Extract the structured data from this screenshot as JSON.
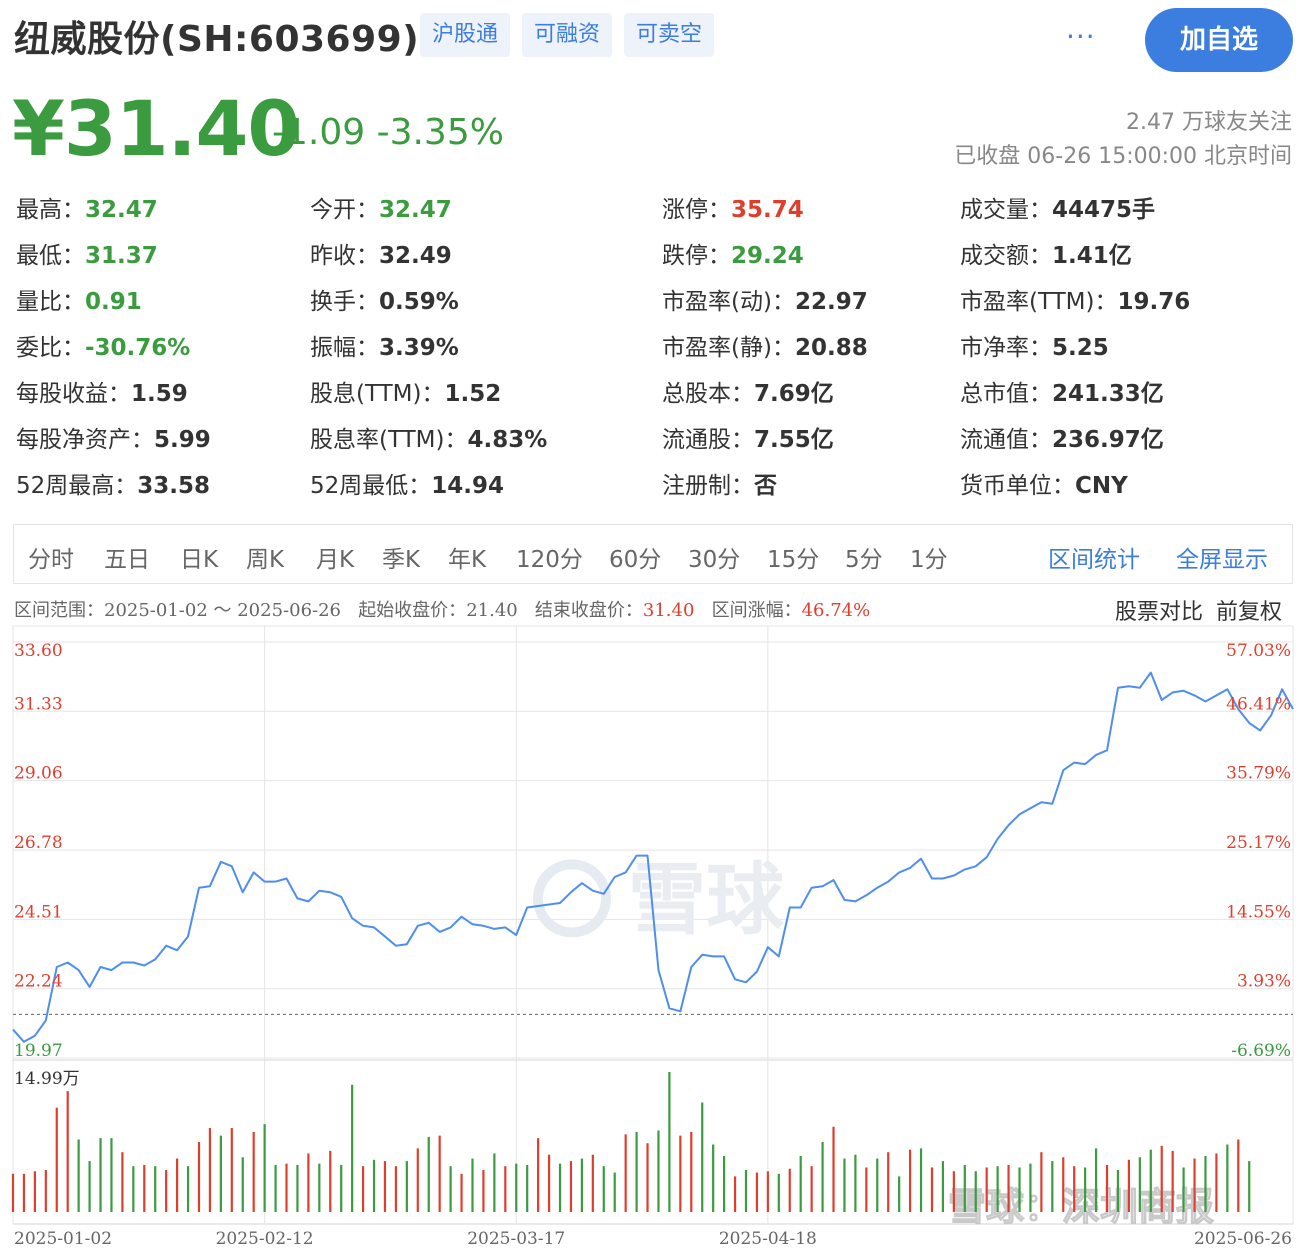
{
  "header": {
    "title": "纽威股份(SH:603699)",
    "tags": [
      "沪股通",
      "可融资",
      "可卖空"
    ],
    "more": "···",
    "add_button": "加自选"
  },
  "quote": {
    "price": "¥31.40",
    "change": "-1.09 -3.35%",
    "followers": "2.47 万球友关注",
    "status_time": "已收盘 06-26 15:00:00 北京时间"
  },
  "stats": {
    "col1": [
      {
        "label": "最高：",
        "value": "32.47",
        "color": "#3a9b3f"
      },
      {
        "label": "最低：",
        "value": "31.37",
        "color": "#3a9b3f"
      },
      {
        "label": "量比：",
        "value": "0.91",
        "color": "#3a9b3f"
      },
      {
        "label": "委比：",
        "value": "-30.76%",
        "color": "#3a9b3f"
      },
      {
        "label": "每股收益：",
        "value": "1.59",
        "color": "#333333"
      },
      {
        "label": "每股净资产：",
        "value": "5.99",
        "color": "#333333"
      },
      {
        "label": "52周最高：",
        "value": "33.58",
        "color": "#333333"
      }
    ],
    "col2": [
      {
        "label": "今开：",
        "value": "32.47",
        "color": "#3a9b3f"
      },
      {
        "label": "昨收：",
        "value": "32.49",
        "color": "#333333"
      },
      {
        "label": "换手：",
        "value": "0.59%",
        "color": "#333333"
      },
      {
        "label": "振幅：",
        "value": "3.39%",
        "color": "#333333"
      },
      {
        "label": "股息(TTM)：",
        "value": "1.52",
        "color": "#333333"
      },
      {
        "label": "股息率(TTM)：",
        "value": "4.83%",
        "color": "#333333"
      },
      {
        "label": "52周最低：",
        "value": "14.94",
        "color": "#333333"
      }
    ],
    "col3": [
      {
        "label": "涨停：",
        "value": "35.74",
        "color": "#e03e2d"
      },
      {
        "label": "跌停：",
        "value": "29.24",
        "color": "#3a9b3f"
      },
      {
        "label": "市盈率(动)：",
        "value": "22.97",
        "color": "#333333"
      },
      {
        "label": "市盈率(静)：",
        "value": "20.88",
        "color": "#333333"
      },
      {
        "label": "总股本：",
        "value": "7.69亿",
        "color": "#333333"
      },
      {
        "label": "流通股：",
        "value": "7.55亿",
        "color": "#333333"
      },
      {
        "label": "注册制：",
        "value": "否",
        "color": "#333333"
      }
    ],
    "col4": [
      {
        "label": "成交量：",
        "value": "44475手",
        "color": "#333333"
      },
      {
        "label": "成交额：",
        "value": "1.41亿",
        "color": "#333333"
      },
      {
        "label": "市盈率(TTM)：",
        "value": "19.76",
        "color": "#333333"
      },
      {
        "label": "市净率：",
        "value": "5.25",
        "color": "#333333"
      },
      {
        "label": "总市值：",
        "value": "241.33亿",
        "color": "#333333"
      },
      {
        "label": "流通值：",
        "value": "236.97亿",
        "color": "#333333"
      },
      {
        "label": "货币单位：",
        "value": "CNY",
        "color": "#333333"
      }
    ]
  },
  "tabs": [
    "分时",
    "五日",
    "日K",
    "周K",
    "月K",
    "季K",
    "年K",
    "120分",
    "60分",
    "30分",
    "15分",
    "5分",
    "1分"
  ],
  "tab_actions": [
    "区间统计",
    "全屏显示"
  ],
  "range": {
    "range_label": "区间范围：",
    "range_value": "2025-01-02 ～ 2025-06-26",
    "start_label": "起始收盘价：",
    "start_value": "21.40",
    "end_label": "结束收盘价：",
    "end_value": "31.40",
    "change_label": "区间涨幅：",
    "change_value": "46.74%",
    "compare": "股票对比",
    "adjust": "前复权"
  },
  "watermark": "雪球",
  "corner_watermark": "雪球：深圳商报",
  "chart_data": {
    "type": "line",
    "y_left_ticks": [
      "33.60",
      "31.33",
      "29.06",
      "26.78",
      "24.51",
      "22.24",
      "19.97"
    ],
    "y_right_ticks": [
      "57.03%",
      "46.41%",
      "35.79%",
      "25.17%",
      "14.55%",
      "3.93%",
      "-6.69%"
    ],
    "ylim": [
      19.97,
      33.6
    ],
    "baseline": 21.4,
    "x_ticks": [
      "2025-01-02",
      "2025-02-12",
      "2025-03-17",
      "2025-04-18",
      "2025-06-26"
    ],
    "x_tick_index": [
      0,
      23,
      46,
      69,
      113
    ],
    "price": [
      20.9,
      20.5,
      20.7,
      21.2,
      22.95,
      23.1,
      22.85,
      22.3,
      22.95,
      22.85,
      23.1,
      23.1,
      23.0,
      23.2,
      23.65,
      23.5,
      23.95,
      25.55,
      25.6,
      26.4,
      26.25,
      25.4,
      26.05,
      25.75,
      25.75,
      25.85,
      25.2,
      25.1,
      25.45,
      25.4,
      25.25,
      24.55,
      24.3,
      24.25,
      23.95,
      23.65,
      23.7,
      24.3,
      24.4,
      24.1,
      24.25,
      24.6,
      24.35,
      24.3,
      24.2,
      24.25,
      24.0,
      24.9,
      24.95,
      25.0,
      25.05,
      25.4,
      25.7,
      25.45,
      25.35,
      25.9,
      26.05,
      26.6,
      26.6,
      22.85,
      21.6,
      21.5,
      22.95,
      23.35,
      23.3,
      23.3,
      22.55,
      22.45,
      22.8,
      23.6,
      23.3,
      24.9,
      24.9,
      25.55,
      25.6,
      25.8,
      25.15,
      25.1,
      25.3,
      25.55,
      25.75,
      26.05,
      26.2,
      26.5,
      25.85,
      25.85,
      25.95,
      26.15,
      26.25,
      26.55,
      27.15,
      27.6,
      27.95,
      28.15,
      28.35,
      28.3,
      29.4,
      29.65,
      29.6,
      29.9,
      30.05,
      32.1,
      32.15,
      32.1,
      32.6,
      31.7,
      31.95,
      32.0,
      31.85,
      31.65,
      31.85,
      32.05,
      31.4,
      30.95,
      30.7,
      31.2,
      32.05,
      31.4
    ],
    "volume_max_label": "14.99万",
    "volume": [
      0.3,
      0.3,
      0.32,
      0.33,
      0.82,
      0.95,
      0.57,
      0.4,
      0.58,
      0.58,
      0.47,
      0.36,
      0.37,
      0.36,
      0.33,
      0.42,
      0.36,
      0.55,
      0.66,
      0.6,
      0.66,
      0.43,
      0.63,
      0.69,
      0.37,
      0.38,
      0.37,
      0.46,
      0.38,
      0.48,
      0.37,
      1.0,
      0.36,
      0.41,
      0.4,
      0.36,
      0.4,
      0.5,
      0.59,
      0.6,
      0.36,
      0.3,
      0.42,
      0.33,
      0.46,
      0.36,
      0.38,
      0.37,
      0.58,
      0.45,
      0.38,
      0.4,
      0.42,
      0.45,
      0.36,
      0.31,
      0.61,
      0.63,
      0.54,
      0.64,
      1.1,
      0.6,
      0.63,
      0.86,
      0.53,
      0.44,
      0.28,
      0.33,
      0.31,
      0.32,
      0.3,
      0.34,
      0.44,
      0.36,
      0.55,
      0.67,
      0.42,
      0.45,
      0.35,
      0.42,
      0.47,
      0.28,
      0.49,
      0.5,
      0.35,
      0.4,
      0.32,
      0.37,
      0.32,
      0.35,
      0.36,
      0.37,
      0.35,
      0.38,
      0.47,
      0.4,
      0.43,
      0.36,
      0.35,
      0.5,
      0.37,
      0.33,
      0.41,
      0.43,
      0.49,
      0.52,
      0.48,
      0.35,
      0.42,
      0.44,
      0.46,
      0.53,
      0.57,
      0.4
    ],
    "volume_up": [
      true,
      true,
      true,
      true,
      true,
      true,
      false,
      false,
      false,
      false,
      true,
      false,
      true,
      false,
      true,
      true,
      false,
      true,
      true,
      false,
      true,
      false,
      true,
      false,
      false,
      true,
      false,
      true,
      false,
      true,
      false,
      false,
      true,
      false,
      true,
      true,
      false,
      true,
      false,
      true,
      false,
      true,
      false,
      true,
      false,
      true,
      false,
      false,
      true,
      true,
      false,
      true,
      false,
      true,
      false,
      false,
      true,
      false,
      true,
      false,
      false,
      true,
      true,
      false,
      false,
      false,
      true,
      false,
      true,
      true,
      false,
      true,
      false,
      true,
      false,
      true,
      false,
      false,
      true,
      false,
      true,
      false,
      true,
      false,
      true,
      false,
      true,
      false,
      false,
      true,
      false,
      true,
      false,
      false,
      true,
      false,
      true,
      true,
      false,
      false,
      true,
      false,
      true,
      false,
      false,
      true,
      true,
      false,
      true,
      false,
      true,
      false,
      true,
      false
    ],
    "colors": {
      "line": "#4f8ef0",
      "up": "#e03e2d",
      "down": "#3a9b3f",
      "grid": "#e5e5e5",
      "baseline": "#666666"
    }
  }
}
